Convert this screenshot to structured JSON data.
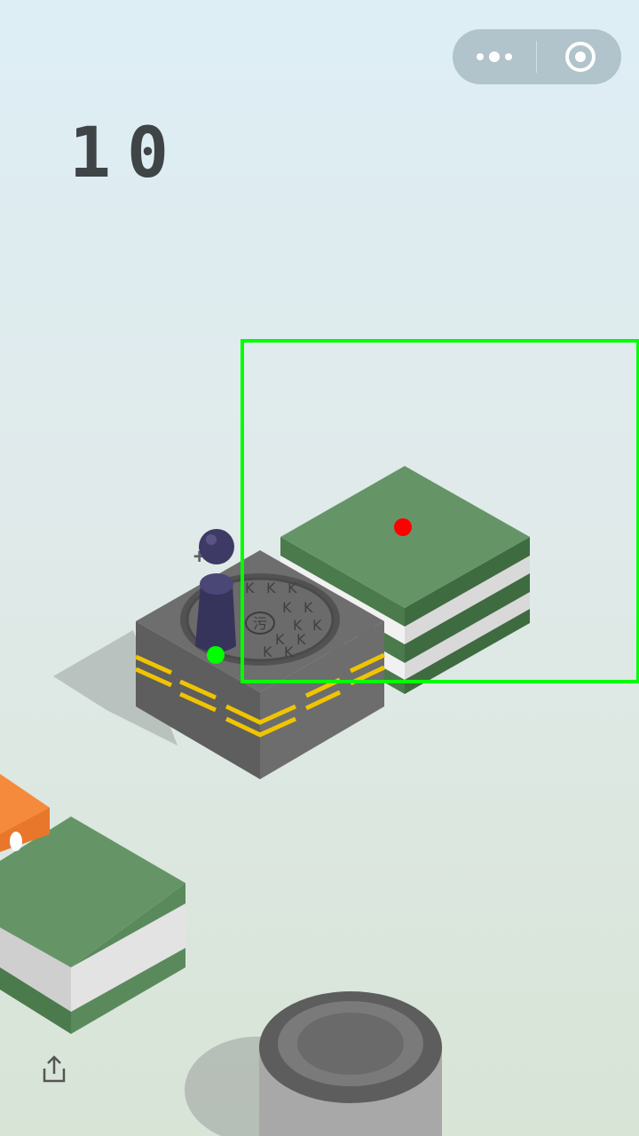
{
  "game": {
    "score": "10",
    "bonus_text": "+4"
  },
  "platforms": {
    "current": {
      "type": "manhole-box",
      "cover_text": "污",
      "cover_pattern": "K"
    },
    "target": {
      "type": "layered-green-block"
    },
    "left": {
      "type": "layered-green-block"
    },
    "edge": {
      "type": "orange-block"
    },
    "front": {
      "type": "grey-cylinder"
    }
  },
  "colors": {
    "accent_green": "#00ff00",
    "target_dot": "#ff0000",
    "block_green": "#659566",
    "box_grey": "#5e5e5e",
    "stripe_yellow": "#f0c400",
    "orange": "#f58a3d"
  },
  "icons": {
    "more": "more-dots-icon",
    "close": "target-circle-icon",
    "share": "share-icon"
  }
}
